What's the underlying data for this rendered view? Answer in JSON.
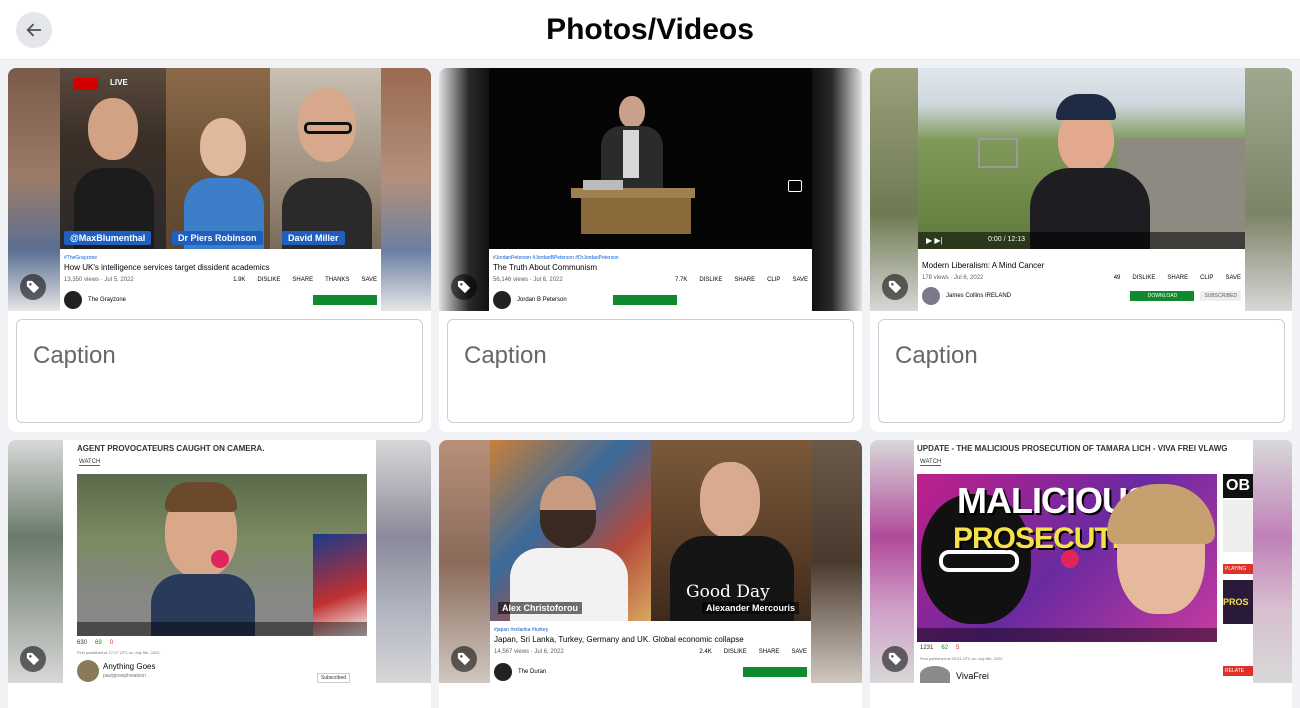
{
  "header": {
    "title": "Photos/Videos"
  },
  "colors": {
    "accent_blue": "#1f5fbf",
    "subscribe_green": "#0f8a2e",
    "yt_link": "#065fd4"
  },
  "cards": [
    {
      "caption_placeholder": "Caption",
      "live_label": "LIVE",
      "name_tags": [
        "@MaxBlumenthal",
        "Dr Piers Robinson",
        "David Miller"
      ],
      "hashtags": "#TheGrayzone",
      "title": "How UK's intelligence services target dissident academics",
      "views": "13,350 views · Jul 5, 2022",
      "likes": "1.9K",
      "actions": [
        "DISLIKE",
        "SHARE",
        "THANKS",
        "SAVE"
      ],
      "channel": "The Grayzone"
    },
    {
      "caption_placeholder": "Caption",
      "hashtags": "#JordanPeterson #JordanBPeterson #DrJordanPeterson",
      "title": "The Truth About Communism",
      "views": "56,146 views · Jul 6, 2022",
      "likes": "7.7K",
      "actions": [
        "DISLIKE",
        "SHARE",
        "CLIP",
        "SAVE"
      ],
      "channel": "Jordan B Peterson"
    },
    {
      "caption_placeholder": "Caption",
      "time": "0:00 / 12:13",
      "title": "Modern Liberalism: A Mind Cancer",
      "views": "178 views · Jul 6, 2022",
      "likes": "49",
      "actions": [
        "DISLIKE",
        "SHARE",
        "CLIP",
        "SAVE"
      ],
      "channel": "James Collins IRELAND",
      "download_label": "DOWNLOAD",
      "subscribed_label": "SUBSCRIBED"
    },
    {
      "title": "AGENT PROVOCATEURS CAUGHT ON CAMERA.",
      "watch_label": "WATCH",
      "views": "630",
      "likes": "69",
      "dislikes": "0",
      "published": "First published at 17:27 UTC on July 5th, 2022.",
      "channel": "Anything Goes",
      "handle": "paulpjosephwatson",
      "subscribed_label": "Subscribed"
    },
    {
      "name_tags": [
        "Alex Christoforou",
        "Alexander Mercouris"
      ],
      "shirt_text": "Good Day",
      "hashtags": "#japan #srilanka #turkey",
      "title": "Japan, Sri Lanka, Turkey, Germany and UK. Global economic collapse",
      "views": "14,567 views · Jul 6, 2022",
      "likes": "2.4K",
      "actions": [
        "DISLIKE",
        "SHARE",
        "SAVE"
      ],
      "channel": "The Duran"
    },
    {
      "title": "UPDATE - THE MALICIOUS PROSECUTION OF TAMARA LICH - VIVA FREI VLAWG",
      "watch_label": "WATCH",
      "thumb_line1": "MALICIOUS",
      "thumb_line2": "PROSECUTION!",
      "views": "1231",
      "likes": "62",
      "dislikes": "5",
      "published": "First published at 03:01 UTC on July 6th, 2022.",
      "channel": "VivaFrei",
      "side_label_1": "OB",
      "side_label_2": "PLAYING",
      "side_label_3": "PROS",
      "side_label_4": "RELATE"
    }
  ]
}
